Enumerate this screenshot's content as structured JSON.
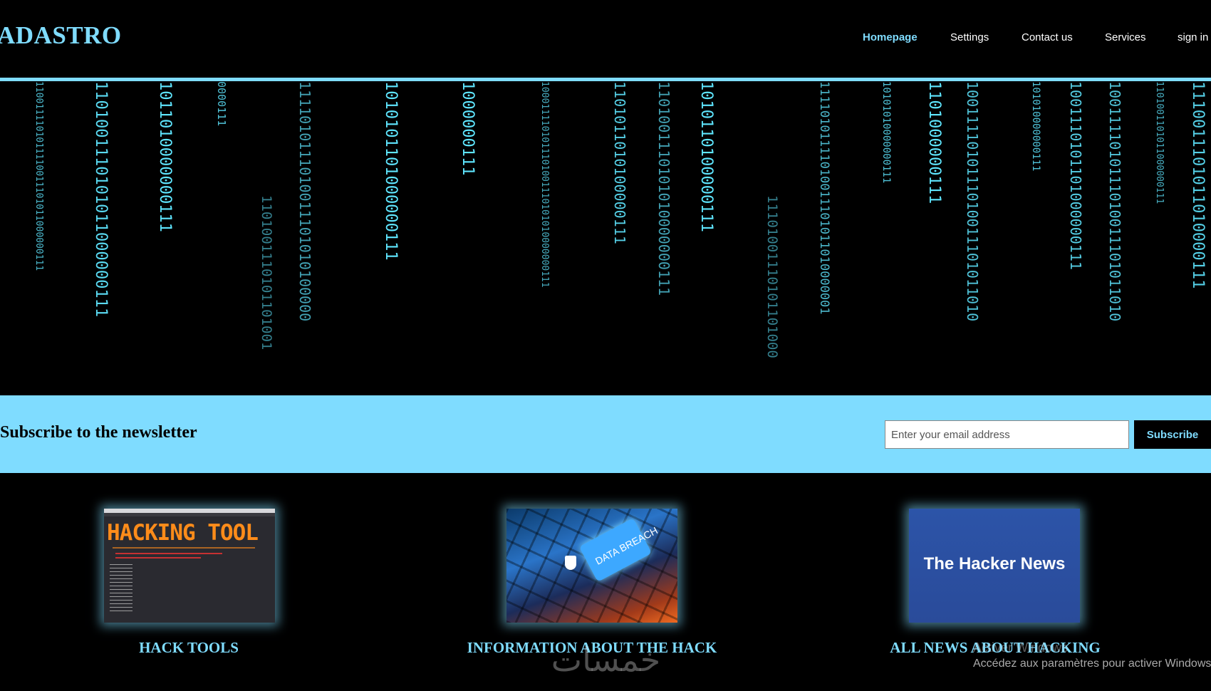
{
  "header": {
    "logo": "ADASTRO",
    "nav": [
      {
        "label": "Homepage",
        "active": true
      },
      {
        "label": "Settings",
        "active": false
      },
      {
        "label": "Contact us",
        "active": false
      },
      {
        "label": "Services",
        "active": false
      },
      {
        "label": "sign in",
        "active": false
      }
    ]
  },
  "hero": {
    "columns": [
      "1100111101011110011101011000000111",
      "1101001110101011000000111",
      "1011010000000111",
      "0000111",
      "1101001110101101001",
      "1111010111010011101010100000",
      "1010101101000000111",
      "1000000111",
      "1000111101011101001110101010000000111",
      "1101011010100000111",
      "1101001110101010000000111",
      "1010110100000111",
      "11101001110101101000",
      "11110101111010011101011010000001",
      "10101010000000111",
      "1101000000111",
      "1001111010111010011101011010",
      "101010000000111",
      "1001110101101000000111",
      "1001111010111010011101011010",
      "1101001101011000000111",
      "1110011101011010000111"
    ]
  },
  "newsletter": {
    "title": "Subscribe to the newsletter",
    "placeholder": "Enter your email address",
    "button": "Subscribe"
  },
  "cards": [
    {
      "title": "HACK TOOLS",
      "image_text": "HACKING TOOL",
      "icon": "terminal-screenshot"
    },
    {
      "title": "INFORMATION ABOUT THE HACK",
      "image_text": "DATA BREACH",
      "icon": "data-breach-keyboard"
    },
    {
      "title": "ALL NEWS ABOUT HACKING",
      "image_text": "The Hacker News",
      "icon": "hacker-news-logo"
    }
  ],
  "overlay": {
    "activation_line1": "Activer Windows",
    "activation_line2": "Accédez aux paramètres pour activer Windows",
    "watermark_logo": "خمسات"
  },
  "colors": {
    "accent": "#7fdcff",
    "background": "#000000",
    "binary_text": "#5fe6ff"
  }
}
